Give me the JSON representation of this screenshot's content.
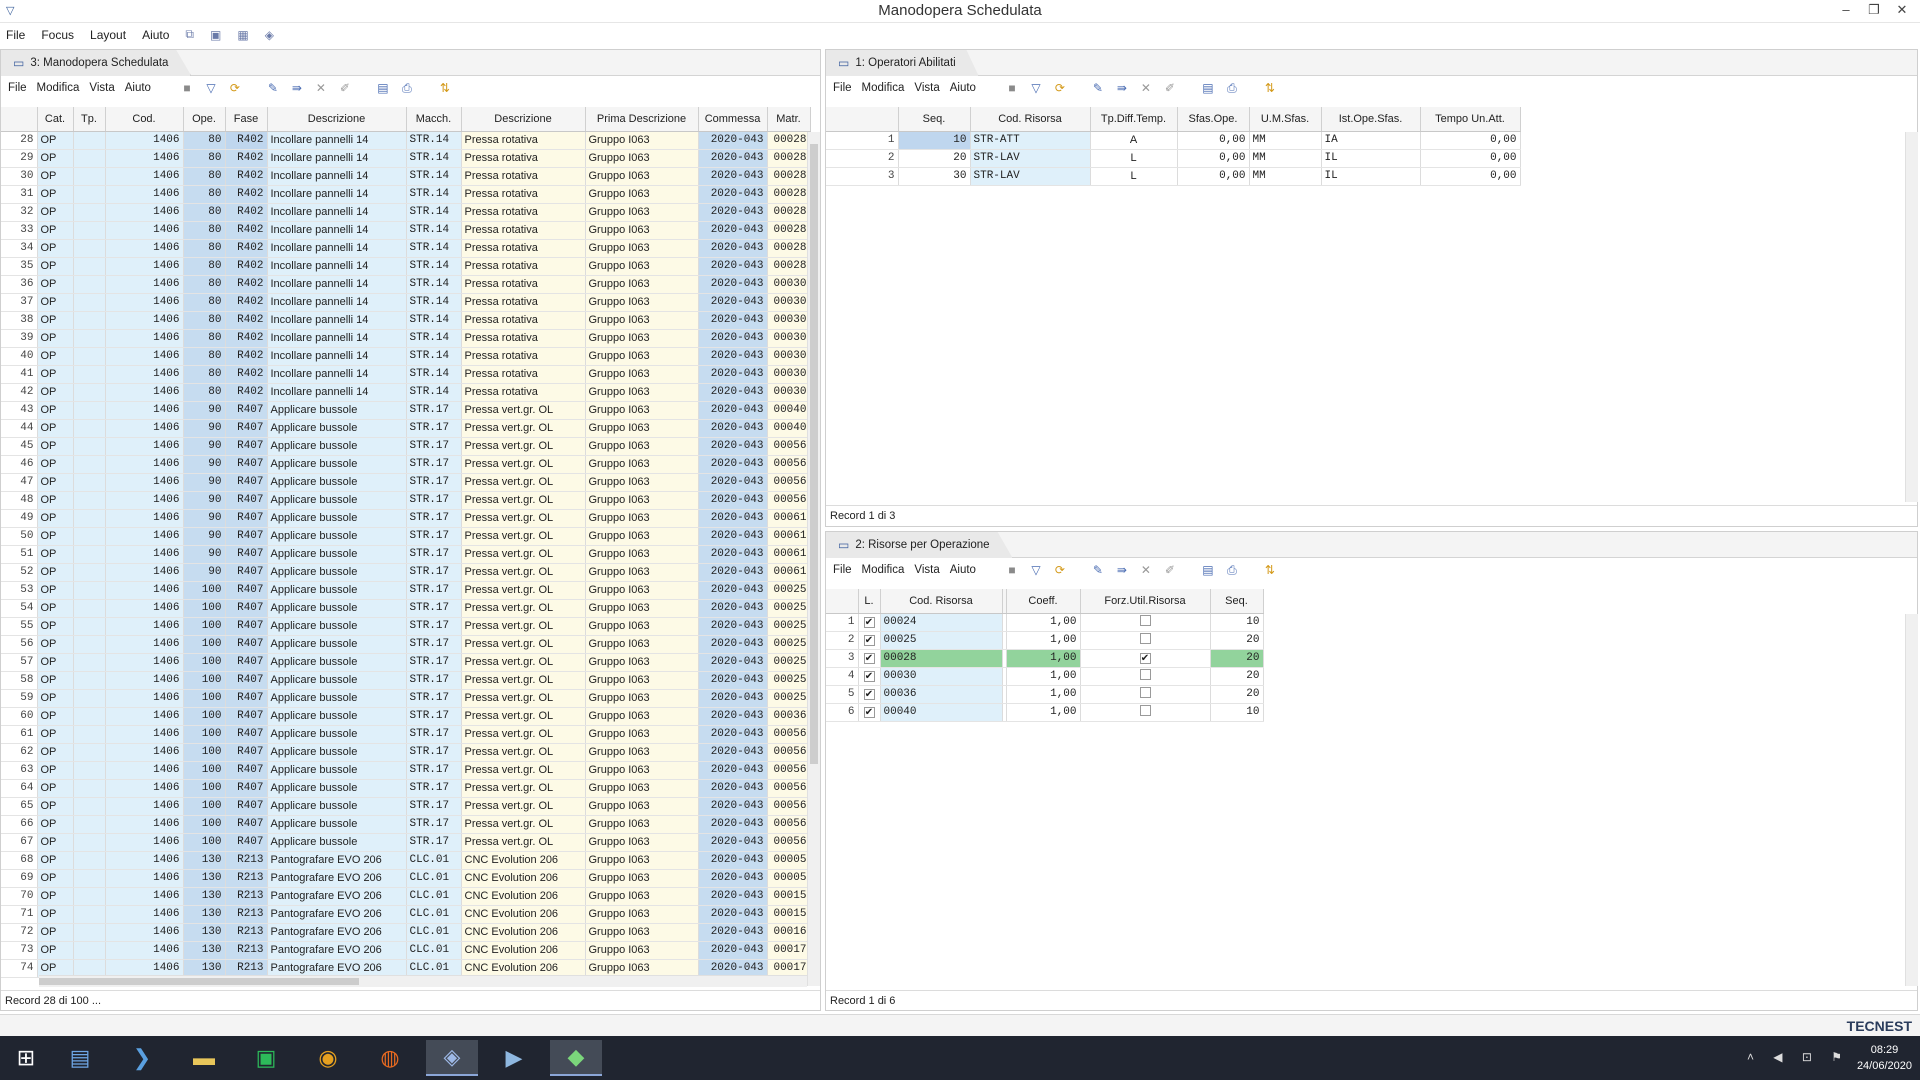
{
  "window": {
    "title": "Manodopera Schedulata",
    "icon": "app-icon",
    "controls": [
      "–",
      "❐",
      "✕"
    ]
  },
  "menu": {
    "items": [
      "File",
      "Focus",
      "Layout",
      "Aiuto"
    ]
  },
  "submenu": {
    "items": [
      "File",
      "Modifica",
      "Vista",
      "Aiuto"
    ]
  },
  "panel1": {
    "tab": "3: Manodopera Schedulata",
    "status": "Record 28 di 100 ...",
    "columns": [
      "",
      "Cat.",
      "Tp.",
      "Cod.",
      "Ope.",
      "Fase",
      "Descrizione",
      "Macch.",
      "Descrizione",
      "Prima Descrizione",
      "Commessa",
      "Matr."
    ],
    "rows": [
      [
        "28",
        "OP",
        "",
        "1406",
        "80",
        "R402",
        "Incollare pannelli 14",
        "STR.14",
        "Pressa rotativa",
        "Gruppo I063",
        "2020-043",
        "00028"
      ],
      [
        "29",
        "OP",
        "",
        "1406",
        "80",
        "R402",
        "Incollare pannelli 14",
        "STR.14",
        "Pressa rotativa",
        "Gruppo I063",
        "2020-043",
        "00028"
      ],
      [
        "30",
        "OP",
        "",
        "1406",
        "80",
        "R402",
        "Incollare pannelli 14",
        "STR.14",
        "Pressa rotativa",
        "Gruppo I063",
        "2020-043",
        "00028"
      ],
      [
        "31",
        "OP",
        "",
        "1406",
        "80",
        "R402",
        "Incollare pannelli 14",
        "STR.14",
        "Pressa rotativa",
        "Gruppo I063",
        "2020-043",
        "00028"
      ],
      [
        "32",
        "OP",
        "",
        "1406",
        "80",
        "R402",
        "Incollare pannelli 14",
        "STR.14",
        "Pressa rotativa",
        "Gruppo I063",
        "2020-043",
        "00028"
      ],
      [
        "33",
        "OP",
        "",
        "1406",
        "80",
        "R402",
        "Incollare pannelli 14",
        "STR.14",
        "Pressa rotativa",
        "Gruppo I063",
        "2020-043",
        "00028"
      ],
      [
        "34",
        "OP",
        "",
        "1406",
        "80",
        "R402",
        "Incollare pannelli 14",
        "STR.14",
        "Pressa rotativa",
        "Gruppo I063",
        "2020-043",
        "00028"
      ],
      [
        "35",
        "OP",
        "",
        "1406",
        "80",
        "R402",
        "Incollare pannelli 14",
        "STR.14",
        "Pressa rotativa",
        "Gruppo I063",
        "2020-043",
        "00028"
      ],
      [
        "36",
        "OP",
        "",
        "1406",
        "80",
        "R402",
        "Incollare pannelli 14",
        "STR.14",
        "Pressa rotativa",
        "Gruppo I063",
        "2020-043",
        "00030"
      ],
      [
        "37",
        "OP",
        "",
        "1406",
        "80",
        "R402",
        "Incollare pannelli 14",
        "STR.14",
        "Pressa rotativa",
        "Gruppo I063",
        "2020-043",
        "00030"
      ],
      [
        "38",
        "OP",
        "",
        "1406",
        "80",
        "R402",
        "Incollare pannelli 14",
        "STR.14",
        "Pressa rotativa",
        "Gruppo I063",
        "2020-043",
        "00030"
      ],
      [
        "39",
        "OP",
        "",
        "1406",
        "80",
        "R402",
        "Incollare pannelli 14",
        "STR.14",
        "Pressa rotativa",
        "Gruppo I063",
        "2020-043",
        "00030"
      ],
      [
        "40",
        "OP",
        "",
        "1406",
        "80",
        "R402",
        "Incollare pannelli 14",
        "STR.14",
        "Pressa rotativa",
        "Gruppo I063",
        "2020-043",
        "00030"
      ],
      [
        "41",
        "OP",
        "",
        "1406",
        "80",
        "R402",
        "Incollare pannelli 14",
        "STR.14",
        "Pressa rotativa",
        "Gruppo I063",
        "2020-043",
        "00030"
      ],
      [
        "42",
        "OP",
        "",
        "1406",
        "80",
        "R402",
        "Incollare pannelli 14",
        "STR.14",
        "Pressa rotativa",
        "Gruppo I063",
        "2020-043",
        "00030"
      ],
      [
        "43",
        "OP",
        "",
        "1406",
        "90",
        "R407",
        "Applicare bussole",
        "STR.17",
        "Pressa vert.gr. OL",
        "Gruppo I063",
        "2020-043",
        "00040"
      ],
      [
        "44",
        "OP",
        "",
        "1406",
        "90",
        "R407",
        "Applicare bussole",
        "STR.17",
        "Pressa vert.gr. OL",
        "Gruppo I063",
        "2020-043",
        "00040"
      ],
      [
        "45",
        "OP",
        "",
        "1406",
        "90",
        "R407",
        "Applicare bussole",
        "STR.17",
        "Pressa vert.gr. OL",
        "Gruppo I063",
        "2020-043",
        "00056"
      ],
      [
        "46",
        "OP",
        "",
        "1406",
        "90",
        "R407",
        "Applicare bussole",
        "STR.17",
        "Pressa vert.gr. OL",
        "Gruppo I063",
        "2020-043",
        "00056"
      ],
      [
        "47",
        "OP",
        "",
        "1406",
        "90",
        "R407",
        "Applicare bussole",
        "STR.17",
        "Pressa vert.gr. OL",
        "Gruppo I063",
        "2020-043",
        "00056"
      ],
      [
        "48",
        "OP",
        "",
        "1406",
        "90",
        "R407",
        "Applicare bussole",
        "STR.17",
        "Pressa vert.gr. OL",
        "Gruppo I063",
        "2020-043",
        "00056"
      ],
      [
        "49",
        "OP",
        "",
        "1406",
        "90",
        "R407",
        "Applicare bussole",
        "STR.17",
        "Pressa vert.gr. OL",
        "Gruppo I063",
        "2020-043",
        "00061"
      ],
      [
        "50",
        "OP",
        "",
        "1406",
        "90",
        "R407",
        "Applicare bussole",
        "STR.17",
        "Pressa vert.gr. OL",
        "Gruppo I063",
        "2020-043",
        "00061"
      ],
      [
        "51",
        "OP",
        "",
        "1406",
        "90",
        "R407",
        "Applicare bussole",
        "STR.17",
        "Pressa vert.gr. OL",
        "Gruppo I063",
        "2020-043",
        "00061"
      ],
      [
        "52",
        "OP",
        "",
        "1406",
        "90",
        "R407",
        "Applicare bussole",
        "STR.17",
        "Pressa vert.gr. OL",
        "Gruppo I063",
        "2020-043",
        "00061"
      ],
      [
        "53",
        "OP",
        "",
        "1406",
        "100",
        "R407",
        "Applicare bussole",
        "STR.17",
        "Pressa vert.gr. OL",
        "Gruppo I063",
        "2020-043",
        "00025"
      ],
      [
        "54",
        "OP",
        "",
        "1406",
        "100",
        "R407",
        "Applicare bussole",
        "STR.17",
        "Pressa vert.gr. OL",
        "Gruppo I063",
        "2020-043",
        "00025"
      ],
      [
        "55",
        "OP",
        "",
        "1406",
        "100",
        "R407",
        "Applicare bussole",
        "STR.17",
        "Pressa vert.gr. OL",
        "Gruppo I063",
        "2020-043",
        "00025"
      ],
      [
        "56",
        "OP",
        "",
        "1406",
        "100",
        "R407",
        "Applicare bussole",
        "STR.17",
        "Pressa vert.gr. OL",
        "Gruppo I063",
        "2020-043",
        "00025"
      ],
      [
        "57",
        "OP",
        "",
        "1406",
        "100",
        "R407",
        "Applicare bussole",
        "STR.17",
        "Pressa vert.gr. OL",
        "Gruppo I063",
        "2020-043",
        "00025"
      ],
      [
        "58",
        "OP",
        "",
        "1406",
        "100",
        "R407",
        "Applicare bussole",
        "STR.17",
        "Pressa vert.gr. OL",
        "Gruppo I063",
        "2020-043",
        "00025"
      ],
      [
        "59",
        "OP",
        "",
        "1406",
        "100",
        "R407",
        "Applicare bussole",
        "STR.17",
        "Pressa vert.gr. OL",
        "Gruppo I063",
        "2020-043",
        "00025"
      ],
      [
        "60",
        "OP",
        "",
        "1406",
        "100",
        "R407",
        "Applicare bussole",
        "STR.17",
        "Pressa vert.gr. OL",
        "Gruppo I063",
        "2020-043",
        "00036"
      ],
      [
        "61",
        "OP",
        "",
        "1406",
        "100",
        "R407",
        "Applicare bussole",
        "STR.17",
        "Pressa vert.gr. OL",
        "Gruppo I063",
        "2020-043",
        "00056"
      ],
      [
        "62",
        "OP",
        "",
        "1406",
        "100",
        "R407",
        "Applicare bussole",
        "STR.17",
        "Pressa vert.gr. OL",
        "Gruppo I063",
        "2020-043",
        "00056"
      ],
      [
        "63",
        "OP",
        "",
        "1406",
        "100",
        "R407",
        "Applicare bussole",
        "STR.17",
        "Pressa vert.gr. OL",
        "Gruppo I063",
        "2020-043",
        "00056"
      ],
      [
        "64",
        "OP",
        "",
        "1406",
        "100",
        "R407",
        "Applicare bussole",
        "STR.17",
        "Pressa vert.gr. OL",
        "Gruppo I063",
        "2020-043",
        "00056"
      ],
      [
        "65",
        "OP",
        "",
        "1406",
        "100",
        "R407",
        "Applicare bussole",
        "STR.17",
        "Pressa vert.gr. OL",
        "Gruppo I063",
        "2020-043",
        "00056"
      ],
      [
        "66",
        "OP",
        "",
        "1406",
        "100",
        "R407",
        "Applicare bussole",
        "STR.17",
        "Pressa vert.gr. OL",
        "Gruppo I063",
        "2020-043",
        "00056"
      ],
      [
        "67",
        "OP",
        "",
        "1406",
        "100",
        "R407",
        "Applicare bussole",
        "STR.17",
        "Pressa vert.gr. OL",
        "Gruppo I063",
        "2020-043",
        "00056"
      ],
      [
        "68",
        "OP",
        "",
        "1406",
        "130",
        "R213",
        "Pantografare EVO 206",
        "CLC.01",
        "CNC Evolution 206",
        "Gruppo I063",
        "2020-043",
        "00005"
      ],
      [
        "69",
        "OP",
        "",
        "1406",
        "130",
        "R213",
        "Pantografare EVO 206",
        "CLC.01",
        "CNC Evolution 206",
        "Gruppo I063",
        "2020-043",
        "00005"
      ],
      [
        "70",
        "OP",
        "",
        "1406",
        "130",
        "R213",
        "Pantografare EVO 206",
        "CLC.01",
        "CNC Evolution 206",
        "Gruppo I063",
        "2020-043",
        "00015"
      ],
      [
        "71",
        "OP",
        "",
        "1406",
        "130",
        "R213",
        "Pantografare EVO 206",
        "CLC.01",
        "CNC Evolution 206",
        "Gruppo I063",
        "2020-043",
        "00015"
      ],
      [
        "72",
        "OP",
        "",
        "1406",
        "130",
        "R213",
        "Pantografare EVO 206",
        "CLC.01",
        "CNC Evolution 206",
        "Gruppo I063",
        "2020-043",
        "00016"
      ],
      [
        "73",
        "OP",
        "",
        "1406",
        "130",
        "R213",
        "Pantografare EVO 206",
        "CLC.01",
        "CNC Evolution 206",
        "Gruppo I063",
        "2020-043",
        "00017"
      ],
      [
        "74",
        "OP",
        "",
        "1406",
        "130",
        "R213",
        "Pantografare EVO 206",
        "CLC.01",
        "CNC Evolution 206",
        "Gruppo I063",
        "2020-043",
        "00017"
      ]
    ]
  },
  "panel2": {
    "tab": "1: Operatori Abilitati",
    "status": "Record 1 di 3",
    "columns": [
      "",
      "Seq.",
      "Cod. Risorsa",
      "Tp.Diff.Temp.",
      "Sfas.Ope.",
      "U.M.Sfas.",
      "Ist.Ope.Sfas.",
      "Tempo Un.Att."
    ],
    "rows": [
      [
        "1",
        "10",
        "STR-ATT",
        "A",
        "0,00",
        "MM",
        "IA",
        "0,00"
      ],
      [
        "2",
        "20",
        "STR-LAV",
        "L",
        "0,00",
        "MM",
        "IL",
        "0,00"
      ],
      [
        "3",
        "30",
        "STR-LAV",
        "L",
        "0,00",
        "MM",
        "IL",
        "0,00"
      ]
    ]
  },
  "panel3": {
    "tab": "2: Risorse per Operazione",
    "status": "Record 1 di 6",
    "columns": [
      "",
      "L.",
      "Cod. Risorsa",
      "",
      "Coeff.",
      "Forz.Util.Risorsa",
      "Seq."
    ],
    "rows": [
      [
        "1",
        "✔",
        "00024",
        "",
        "1,00",
        "",
        "10"
      ],
      [
        "2",
        "✔",
        "00025",
        "",
        "1,00",
        "",
        "20"
      ],
      [
        "3",
        "✔",
        "00028",
        "",
        "1,00",
        "✔",
        "20"
      ],
      [
        "4",
        "✔",
        "00030",
        "",
        "1,00",
        "",
        "20"
      ],
      [
        "5",
        "✔",
        "00036",
        "",
        "1,00",
        "",
        "20"
      ],
      [
        "6",
        "✔",
        "00040",
        "",
        "1,00",
        "",
        "10"
      ]
    ]
  },
  "brand": "TECNEST",
  "clock": {
    "time": "08:29",
    "date": "24/06/2020"
  }
}
